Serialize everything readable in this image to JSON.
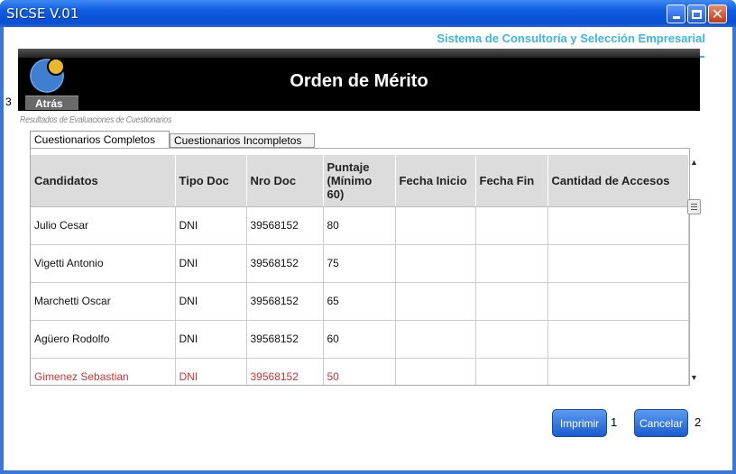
{
  "window": {
    "title": "SICSE V.01"
  },
  "header": {
    "company": "Sistema de Consultoría y Selección Empresarial",
    "page_title": "Orden de Mérito",
    "back_label": "Atrás",
    "marker_3": "3"
  },
  "subtitle": "Resultados de Evaluaciones de Cuestionarios",
  "tabs": [
    {
      "label": "Cuestionarios Completos",
      "active": true
    },
    {
      "label": "Cuestionarios Incompletos",
      "active": false
    }
  ],
  "table": {
    "columns": [
      "Candidatos",
      "Tipo Doc",
      "Nro Doc",
      "Puntaje (Mínimo 60)",
      "Fecha Inicio",
      "Fecha Fin",
      "Cantidad de Accesos"
    ],
    "rows": [
      {
        "candidato": "Julio Cesar",
        "tipo": "DNI",
        "nro": "39568152",
        "puntaje": "80",
        "inicio": "",
        "fin": "",
        "accesos": ""
      },
      {
        "candidato": "Vigetti Antonio",
        "tipo": "DNI",
        "nro": "39568152",
        "puntaje": "75",
        "inicio": "",
        "fin": "",
        "accesos": ""
      },
      {
        "candidato": "Marchetti Oscar",
        "tipo": "DNI",
        "nro": "39568152",
        "puntaje": "65",
        "inicio": "",
        "fin": "",
        "accesos": ""
      },
      {
        "candidato": "Agüero Rodolfo",
        "tipo": "DNI",
        "nro": "39568152",
        "puntaje": "60",
        "inicio": "",
        "fin": "",
        "accesos": ""
      },
      {
        "candidato": "Gimenez Sebastian",
        "tipo": "DNI",
        "nro": "39568152",
        "puntaje": "50",
        "inicio": "",
        "fin": "",
        "accesos": ""
      }
    ]
  },
  "footer": {
    "print_label": "Imprimir",
    "marker_1": "1",
    "cancel_label": "Cancelar",
    "marker_2": "2"
  },
  "colors": {
    "title_bar": "#0a4fd0",
    "accent": "#3ab6e0",
    "below_minimum": "#d93030",
    "button": "#1a5bd0"
  },
  "icons": [
    "minimize-icon",
    "maximize-icon",
    "close-icon",
    "logo-icon",
    "scroll-up-icon",
    "scroll-down-icon"
  ]
}
